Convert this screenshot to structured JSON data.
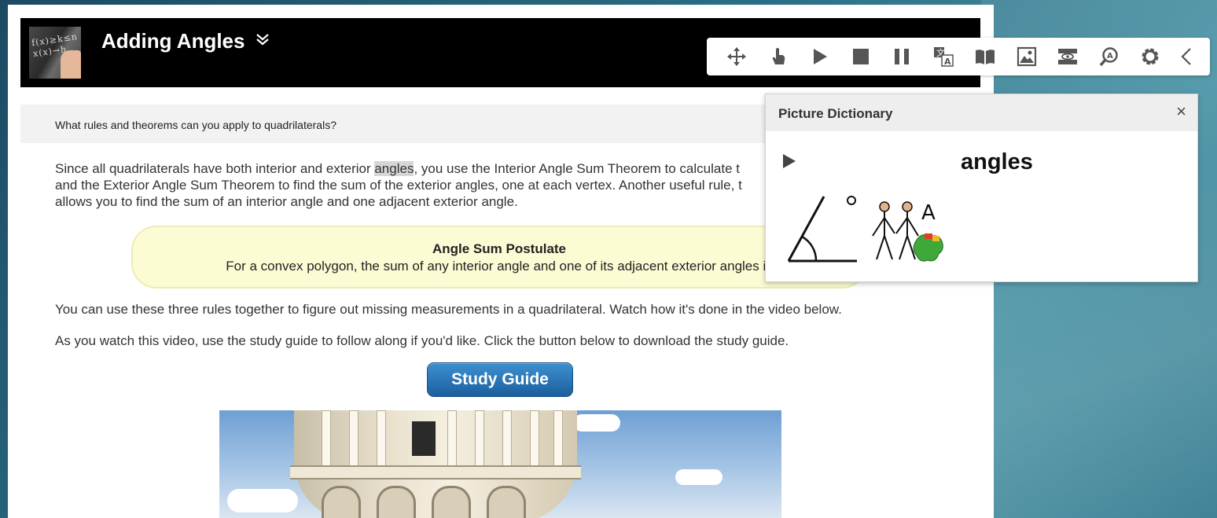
{
  "banner": {
    "title": "Adding Angles",
    "expand_icon": "double-chevron-down-icon",
    "thumbnail_chalk": "f(x)≥k≤n\nx(x)→h"
  },
  "question": "What rules and theorems can you apply to quadrilaterals?",
  "paragraph1": {
    "before": "Since all quadrilaterals have both interior and exterior ",
    "highlight": "angles",
    "after": ", you use the Interior Angle Sum Theorem to calculate t",
    "line2": "and the Exterior Angle Sum Theorem to find the sum of the exterior angles, one at each vertex. Another useful rule, t",
    "line3": "allows you to find the sum of an interior angle and one adjacent exterior angle."
  },
  "postulate": {
    "title": "Angle Sum Postulate",
    "body": "For a convex polygon, the sum of any interior angle and one of its adjacent exterior angles is"
  },
  "paragraph2": "You can use these three rules together to figure out missing measurements in a quadrilateral. Watch how it's done in the video below.",
  "paragraph3": "As you watch this video, use the study guide to follow along if you'd like. Click the button below to download the study guide.",
  "study_guide_button": "Study Guide",
  "toolbar": {
    "buttons": [
      "move-icon",
      "point-hand-icon",
      "play-icon",
      "stop-icon",
      "pause-icon",
      "translate-icon",
      "dictionary-book-icon",
      "picture-dictionary-icon",
      "screen-mask-icon",
      "text-magnifier-icon",
      "settings-gear-icon",
      "collapse-chevron-left-icon"
    ]
  },
  "picture_dictionary": {
    "title": "Picture Dictionary",
    "close": "×",
    "word": "angles",
    "symbol_letters": "A",
    "symbol_degree": "o"
  },
  "colors": {
    "banner": "#000000",
    "question_bar": "#f2f2f2",
    "postulate_bg": "#fcfcd4",
    "button_blue": "#1b5f9d",
    "highlight": "#d6d6d6"
  }
}
